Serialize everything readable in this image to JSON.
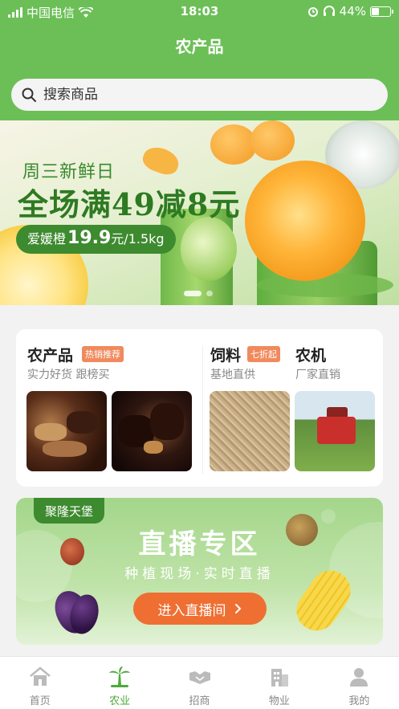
{
  "status_bar": {
    "carrier": "中国电信",
    "time": "18:03",
    "battery": "44%",
    "battery_level": 0.44
  },
  "header": {
    "title": "农产品"
  },
  "search": {
    "placeholder": "搜索商品"
  },
  "banner": {
    "subtitle": "周三新鲜日",
    "headline": "全场满49减8元",
    "price_name": "爱媛橙",
    "price_value": "19.9",
    "price_unit": "元/1.5kg",
    "active_page": 1,
    "page_count": 2
  },
  "categories": [
    {
      "title": "农产品",
      "tag": "热销推荐",
      "subtitle": "实力好货 跟榜买"
    },
    {
      "title": "饲料",
      "tag": "七折起",
      "subtitle": "基地直供"
    },
    {
      "title": "农机",
      "tag": "",
      "subtitle": "厂家直销"
    }
  ],
  "live": {
    "badge": "聚隆天堡",
    "title": "直播专区",
    "subtitle": "种植现场·实时直播",
    "button": "进入直播间",
    "button_icon": "chevron-right-icon"
  },
  "tabbar": [
    {
      "label": "首页",
      "icon": "home-icon",
      "active": false
    },
    {
      "label": "农业",
      "icon": "palm-tree-icon",
      "active": true
    },
    {
      "label": "招商",
      "icon": "handshake-icon",
      "active": false
    },
    {
      "label": "物业",
      "icon": "building-icon",
      "active": false
    },
    {
      "label": "我的",
      "icon": "user-icon",
      "active": false
    }
  ],
  "colors": {
    "primary_green": "#6cbf57",
    "active_tab": "#4caa3a",
    "tag_orange": "#f08a5d",
    "live_button": "#ef6f33"
  }
}
